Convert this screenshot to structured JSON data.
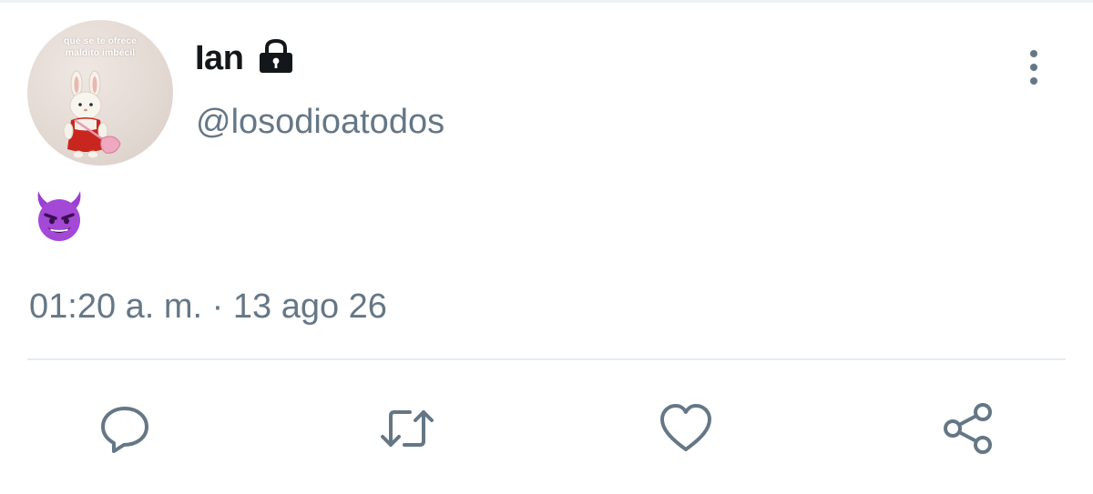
{
  "profile": {
    "display_name": "Ian",
    "handle": "@losodioatodos",
    "avatar_caption": "qué se te ofrece maldito imbécil",
    "protected_icon": "lock-icon"
  },
  "tweet": {
    "emoji": "😈",
    "timestamp": "01:20 a. m. · 13 ago 26"
  },
  "menu": {
    "icon": "more-vertical-icon"
  },
  "actions": [
    {
      "name": "reply",
      "icon": "comment-icon"
    },
    {
      "name": "retweet",
      "icon": "retweet-icon"
    },
    {
      "name": "like",
      "icon": "heart-icon"
    },
    {
      "name": "share",
      "icon": "share-icon"
    }
  ],
  "colors": {
    "text_primary": "#14171a",
    "text_secondary": "#657786",
    "divider": "#e6ecf0",
    "emoji_purple": "#9a3fd1"
  }
}
